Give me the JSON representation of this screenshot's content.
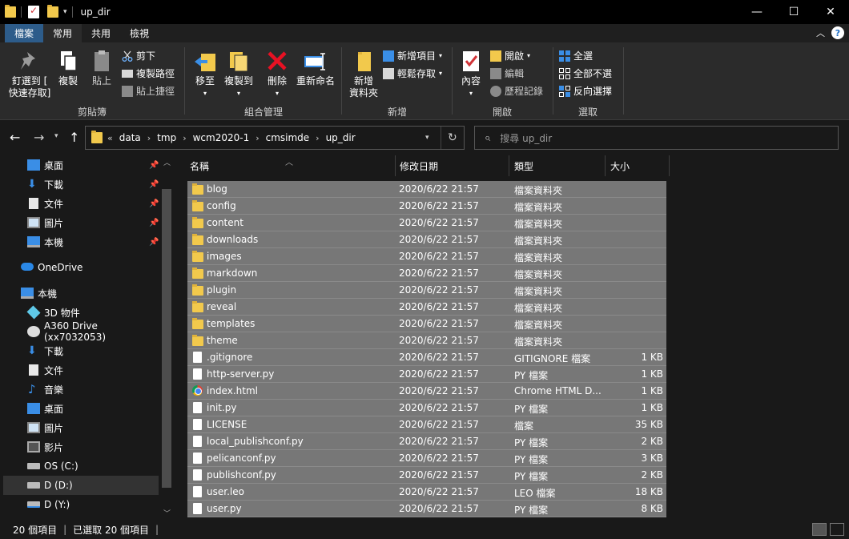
{
  "window": {
    "title": "up_dir",
    "minimize": "—",
    "maximize": "☐",
    "close": "✕"
  },
  "ribbon_tabs": {
    "file": "檔案",
    "home": "常用",
    "share": "共用",
    "view": "檢視"
  },
  "ribbon": {
    "clipboard": {
      "label": "剪貼簿",
      "pin_line1": "釘選到 [",
      "pin_line2": "快速存取]",
      "copy": "複製",
      "paste": "貼上",
      "cut": "剪下",
      "copy_path": "複製路徑",
      "paste_shortcut": "貼上捷徑"
    },
    "organize": {
      "label": "組合管理",
      "move_to": "移至",
      "copy_to": "複製到",
      "delete": "刪除",
      "rename": "重新命名"
    },
    "new": {
      "label": "新增",
      "new_folder_line1": "新增",
      "new_folder_line2": "資料夾",
      "new_item": "新增項目",
      "easy_access": "輕鬆存取"
    },
    "open": {
      "label": "開啟",
      "properties": "內容",
      "open": "開啟",
      "edit": "編輯",
      "history": "歷程記錄"
    },
    "select": {
      "label": "選取",
      "select_all": "全選",
      "select_none": "全部不選",
      "invert": "反向選擇"
    }
  },
  "address": {
    "overflow": "«",
    "crumbs": [
      "data",
      "tmp",
      "wcm2020-1",
      "cmsimde",
      "up_dir"
    ],
    "separator": "›",
    "search_placeholder": "搜尋 up_dir"
  },
  "nav": {
    "quick_access": [
      {
        "label": "桌面",
        "icon": "desktop-icon"
      },
      {
        "label": "下載",
        "icon": "download-icon"
      },
      {
        "label": "文件",
        "icon": "document-icon"
      },
      {
        "label": "圖片",
        "icon": "pictures-icon"
      },
      {
        "label": "本機",
        "icon": "computer-icon"
      }
    ],
    "onedrive": "OneDrive",
    "this_pc": "本機",
    "pc_items": [
      {
        "label": "3D 物件",
        "icon": "3d-objects-icon"
      },
      {
        "label": "A360 Drive (xx7032053)",
        "icon": "cloud-drive-icon"
      },
      {
        "label": "下載",
        "icon": "download-icon"
      },
      {
        "label": "文件",
        "icon": "document-icon"
      },
      {
        "label": "音樂",
        "icon": "music-icon"
      },
      {
        "label": "桌面",
        "icon": "desktop-icon"
      },
      {
        "label": "圖片",
        "icon": "pictures-icon"
      },
      {
        "label": "影片",
        "icon": "videos-icon"
      },
      {
        "label": "OS (C:)",
        "icon": "drive-icon"
      },
      {
        "label": "D (D:)",
        "icon": "drive-icon"
      },
      {
        "label": "D (Y:)",
        "icon": "network-drive-icon"
      }
    ]
  },
  "columns": {
    "name": "名稱",
    "modified": "修改日期",
    "type": "類型",
    "size": "大小"
  },
  "files": [
    {
      "name": "blog",
      "date": "2020/6/22 21:57",
      "type": "檔案資料夾",
      "size": "",
      "icon": "folder"
    },
    {
      "name": "config",
      "date": "2020/6/22 21:57",
      "type": "檔案資料夾",
      "size": "",
      "icon": "folder"
    },
    {
      "name": "content",
      "date": "2020/6/22 21:57",
      "type": "檔案資料夾",
      "size": "",
      "icon": "folder"
    },
    {
      "name": "downloads",
      "date": "2020/6/22 21:57",
      "type": "檔案資料夾",
      "size": "",
      "icon": "folder"
    },
    {
      "name": "images",
      "date": "2020/6/22 21:57",
      "type": "檔案資料夾",
      "size": "",
      "icon": "folder"
    },
    {
      "name": "markdown",
      "date": "2020/6/22 21:57",
      "type": "檔案資料夾",
      "size": "",
      "icon": "folder"
    },
    {
      "name": "plugin",
      "date": "2020/6/22 21:57",
      "type": "檔案資料夾",
      "size": "",
      "icon": "folder"
    },
    {
      "name": "reveal",
      "date": "2020/6/22 21:57",
      "type": "檔案資料夾",
      "size": "",
      "icon": "folder"
    },
    {
      "name": "templates",
      "date": "2020/6/22 21:57",
      "type": "檔案資料夾",
      "size": "",
      "icon": "folder"
    },
    {
      "name": "theme",
      "date": "2020/6/22 21:57",
      "type": "檔案資料夾",
      "size": "",
      "icon": "folder"
    },
    {
      "name": ".gitignore",
      "date": "2020/6/22 21:57",
      "type": "GITIGNORE 檔案",
      "size": "1 KB",
      "icon": "doc"
    },
    {
      "name": "http-server.py",
      "date": "2020/6/22 21:57",
      "type": "PY 檔案",
      "size": "1 KB",
      "icon": "doc"
    },
    {
      "name": "index.html",
      "date": "2020/6/22 21:57",
      "type": "Chrome HTML D...",
      "size": "1 KB",
      "icon": "chrome"
    },
    {
      "name": "init.py",
      "date": "2020/6/22 21:57",
      "type": "PY 檔案",
      "size": "1 KB",
      "icon": "doc"
    },
    {
      "name": "LICENSE",
      "date": "2020/6/22 21:57",
      "type": "檔案",
      "size": "35 KB",
      "icon": "doc"
    },
    {
      "name": "local_publishconf.py",
      "date": "2020/6/22 21:57",
      "type": "PY 檔案",
      "size": "2 KB",
      "icon": "doc"
    },
    {
      "name": "pelicanconf.py",
      "date": "2020/6/22 21:57",
      "type": "PY 檔案",
      "size": "3 KB",
      "icon": "doc"
    },
    {
      "name": "publishconf.py",
      "date": "2020/6/22 21:57",
      "type": "PY 檔案",
      "size": "2 KB",
      "icon": "doc"
    },
    {
      "name": "user.leo",
      "date": "2020/6/22 21:57",
      "type": "LEO 檔案",
      "size": "18 KB",
      "icon": "doc"
    },
    {
      "name": "user.py",
      "date": "2020/6/22 21:57",
      "type": "PY 檔案",
      "size": "8 KB",
      "icon": "doc"
    }
  ],
  "status": {
    "count": "20 個項目",
    "selected": "已選取 20 個項目"
  }
}
